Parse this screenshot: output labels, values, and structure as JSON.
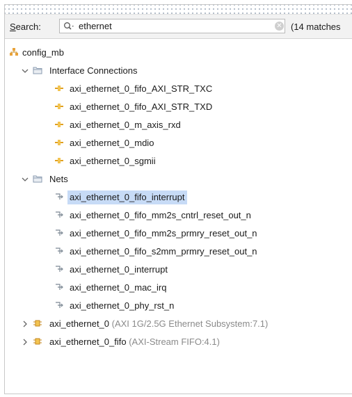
{
  "search": {
    "label_mnemonic": "S",
    "label_rest": "earch:",
    "value": "ethernet",
    "match_count": "(14 matches"
  },
  "tree": {
    "root": {
      "label": "config_mb"
    },
    "interface_folder": {
      "label": "Interface Connections"
    },
    "interfaces": [
      "axi_ethernet_0_fifo_AXI_STR_TXC",
      "axi_ethernet_0_fifo_AXI_STR_TXD",
      "axi_ethernet_0_m_axis_rxd",
      "axi_ethernet_0_mdio",
      "axi_ethernet_0_sgmii"
    ],
    "nets_folder": {
      "label": "Nets"
    },
    "nets": [
      "axi_ethernet_0_fifo_interrupt",
      "axi_ethernet_0_fifo_mm2s_cntrl_reset_out_n",
      "axi_ethernet_0_fifo_mm2s_prmry_reset_out_n",
      "axi_ethernet_0_fifo_s2mm_prmry_reset_out_n",
      "axi_ethernet_0_interrupt",
      "axi_ethernet_0_mac_irq",
      "axi_ethernet_0_phy_rst_n"
    ],
    "cells": [
      {
        "name": "axi_ethernet_0",
        "type": "(AXI 1G/2.5G Ethernet Subsystem:7.1)"
      },
      {
        "name": "axi_ethernet_0_fifo",
        "type": "(AXI-Stream FIFO:4.1)"
      }
    ]
  },
  "colors": {
    "selection": "#c7dbf6",
    "interface_icon": "#e0a020",
    "cell_icon": "#e0a020",
    "folder_icon": "#8a9bb0"
  }
}
